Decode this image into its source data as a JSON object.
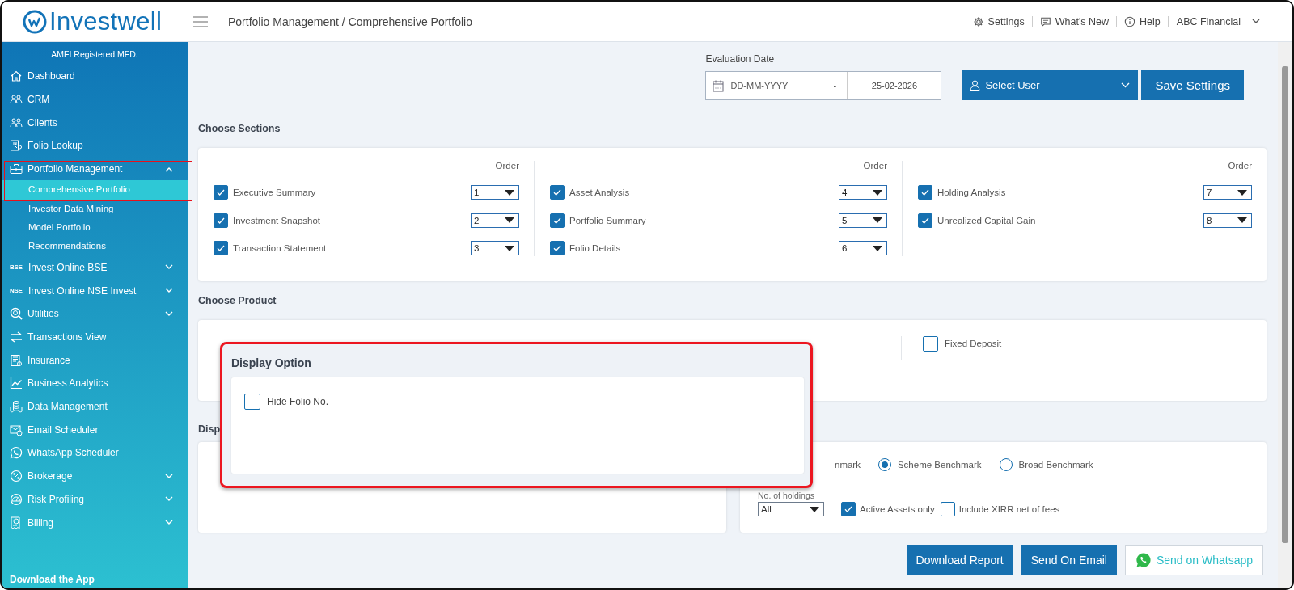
{
  "header": {
    "logo": "Investwell",
    "breadcrumb": "Portfolio Management / Comprehensive Portfolio",
    "links": [
      "Settings",
      "What's New",
      "Help"
    ],
    "account": "ABC Financial"
  },
  "sidebar": {
    "caption": "AMFI Registered MFD.",
    "items": [
      {
        "label": "Dashboard",
        "kind": "link"
      },
      {
        "label": "CRM",
        "kind": "link"
      },
      {
        "label": "Clients",
        "kind": "link"
      },
      {
        "label": "Folio Lookup",
        "kind": "link"
      },
      {
        "label": "Portfolio Management",
        "kind": "group",
        "expanded": true,
        "children": [
          {
            "label": "Comprehensive Portfolio",
            "selected": true
          },
          {
            "label": "Investor Data Mining",
            "selected": false
          },
          {
            "label": "Model Portfolio",
            "selected": false
          },
          {
            "label": "Recommendations",
            "selected": false
          }
        ]
      },
      {
        "label": "Invest Online BSE",
        "kind": "group",
        "expanded": false,
        "badge": "BSE"
      },
      {
        "label": "Invest Online NSE Invest",
        "kind": "group",
        "expanded": false,
        "badge": "NSE"
      },
      {
        "label": "Utilities",
        "kind": "group",
        "expanded": false
      },
      {
        "label": "Transactions View",
        "kind": "link"
      },
      {
        "label": "Insurance",
        "kind": "link"
      },
      {
        "label": "Business Analytics",
        "kind": "link"
      },
      {
        "label": "Data Management",
        "kind": "link"
      },
      {
        "label": "Email Scheduler",
        "kind": "link"
      },
      {
        "label": "WhatsApp Scheduler",
        "kind": "link"
      },
      {
        "label": "Brokerage",
        "kind": "group",
        "expanded": false
      },
      {
        "label": "Risk Profiling",
        "kind": "group",
        "expanded": false
      },
      {
        "label": "Billing",
        "kind": "group",
        "expanded": false
      }
    ],
    "footer": "Download the App"
  },
  "evaluation_date": {
    "label": "Evaluation Date",
    "from": {
      "placeholder": "DD-MM-YYYY"
    },
    "separator": "-",
    "to": "25-02-2026"
  },
  "user_select": {
    "placeholder": "Select User"
  },
  "save_button": "Save Settings",
  "sections": {
    "heading": "Choose Sections",
    "columns": [
      {
        "order_heading": "Order",
        "rows": [
          {
            "label": "Executive Summary",
            "checked": true,
            "order": "1"
          },
          {
            "label": "Investment Snapshot",
            "checked": true,
            "order": "2"
          },
          {
            "label": "Transaction Statement",
            "checked": true,
            "order": "3"
          }
        ]
      },
      {
        "order_heading": "Order",
        "rows": [
          {
            "label": "Asset Analysis",
            "checked": true,
            "order": "4"
          },
          {
            "label": "Portfolio Summary",
            "checked": true,
            "order": "5"
          },
          {
            "label": "Folio Details",
            "checked": true,
            "order": "6"
          }
        ]
      },
      {
        "order_heading": "Order",
        "rows": [
          {
            "label": "Holding Analysis",
            "checked": true,
            "order": "7"
          },
          {
            "label": "Unrealized Capital Gain",
            "checked": true,
            "order": "8"
          }
        ]
      }
    ]
  },
  "product": {
    "heading": "Choose Product",
    "options": [
      {
        "label": "Fixed Deposit",
        "checked": false
      }
    ]
  },
  "display": {
    "heading": "Disp"
  },
  "benchmark": {
    "cut_label": "nmark",
    "options": [
      {
        "label": "Scheme Benchmark",
        "selected": true
      },
      {
        "label": "Broad Benchmark",
        "selected": false
      }
    ]
  },
  "holdings": {
    "label": "No. of holdings",
    "value": "All"
  },
  "filters": [
    {
      "label": "Active Assets only",
      "checked": true
    },
    {
      "label": "Include XIRR net of fees",
      "checked": false
    }
  ],
  "actions": [
    {
      "label": "Download Report",
      "kind": "primary"
    },
    {
      "label": "Send On Email",
      "kind": "primary"
    },
    {
      "label": "Send on Whatsapp",
      "kind": "whatsapp"
    }
  ],
  "popup": {
    "title": "Display Option",
    "options": [
      {
        "label": "Hide Folio No.",
        "checked": false
      }
    ]
  }
}
